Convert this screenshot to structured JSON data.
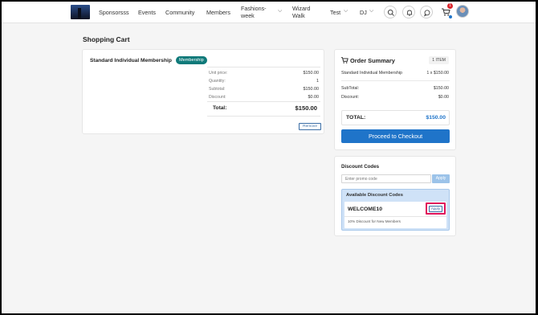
{
  "nav": {
    "items": [
      "Sponsorsss",
      "Events",
      "Community",
      "Members"
    ],
    "fashions_line1": "Fashions-",
    "fashions_line2": "week",
    "wizard_line1": "Wizard",
    "wizard_line2": "Walk",
    "test": "Test",
    "user_initials": "DJ",
    "cart_count": "1"
  },
  "page": {
    "title": "Shopping Cart"
  },
  "cart_item": {
    "name": "Standard Individual Membership",
    "tag": "Membership",
    "rows": [
      {
        "label": "Unit price:",
        "value": "$150.00"
      },
      {
        "label": "Quantity:",
        "value": "1"
      },
      {
        "label": "Subtotal:",
        "value": "$150.00"
      },
      {
        "label": "Discount:",
        "value": "$0.00"
      }
    ],
    "total_label": "Total:",
    "total_value": "$150.00",
    "remove_label": "Remove"
  },
  "summary": {
    "title": "Order Summary",
    "items_count": "1 ITEM",
    "line_name": "Standard Individual Membership",
    "line_qty": "1 x $150.00",
    "subtotal_label": "SubTotal:",
    "subtotal_value": "$150.00",
    "discount_label": "Discount:",
    "discount_value": "$0.00",
    "total_label": "TOTAL:",
    "total_value": "$150.00",
    "checkout_label": "Proceed to Checkout",
    "accent": "#1f74c9"
  },
  "discount": {
    "title": "Discount Codes",
    "placeholder": "Enter promo code",
    "apply_label": "Apply",
    "available_title": "Available Discount Codes",
    "codes": [
      {
        "code": "WELCOME10",
        "apply_label": "Apply",
        "description": "10% Discount for New Members"
      }
    ]
  }
}
